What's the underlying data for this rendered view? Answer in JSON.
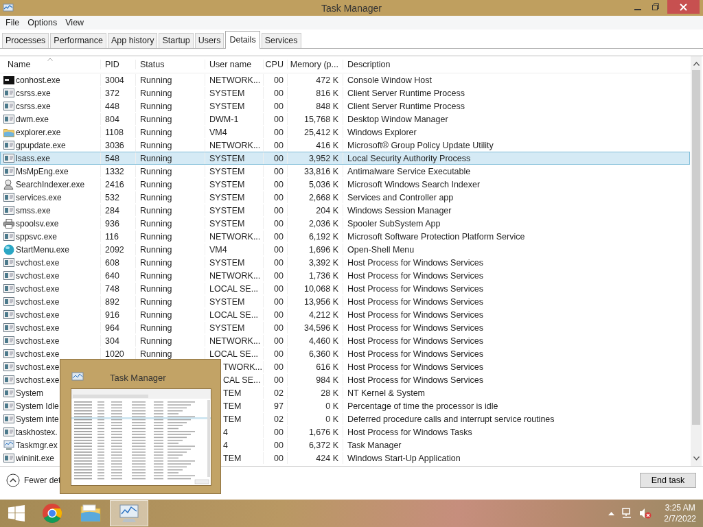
{
  "window": {
    "title": "Task Manager"
  },
  "menu": [
    "File",
    "Options",
    "View"
  ],
  "tabs": [
    {
      "label": "Processes",
      "selected": false
    },
    {
      "label": "Performance",
      "selected": false
    },
    {
      "label": "App history",
      "selected": false
    },
    {
      "label": "Startup",
      "selected": false
    },
    {
      "label": "Users",
      "selected": false
    },
    {
      "label": "Details",
      "selected": true
    },
    {
      "label": "Services",
      "selected": false
    }
  ],
  "table": {
    "columns": [
      "Name",
      "PID",
      "Status",
      "User name",
      "CPU",
      "Memory (p...",
      "Description"
    ],
    "rows": [
      {
        "kind": "console",
        "name": "conhost.exe",
        "pid": "3004",
        "status": "Running",
        "user": "NETWORK...",
        "cpu": "00",
        "memory": "472 K",
        "description": "Console Window Host",
        "selected": false
      },
      {
        "kind": "app",
        "name": "csrss.exe",
        "pid": "372",
        "status": "Running",
        "user": "SYSTEM",
        "cpu": "00",
        "memory": "816 K",
        "description": "Client Server Runtime Process",
        "selected": false
      },
      {
        "kind": "app",
        "name": "csrss.exe",
        "pid": "448",
        "status": "Running",
        "user": "SYSTEM",
        "cpu": "00",
        "memory": "848 K",
        "description": "Client Server Runtime Process",
        "selected": false
      },
      {
        "kind": "app",
        "name": "dwm.exe",
        "pid": "804",
        "status": "Running",
        "user": "DWM-1",
        "cpu": "00",
        "memory": "15,768 K",
        "description": "Desktop Window Manager",
        "selected": false
      },
      {
        "kind": "folder",
        "name": "explorer.exe",
        "pid": "1108",
        "status": "Running",
        "user": "VM4",
        "cpu": "00",
        "memory": "25,412 K",
        "description": "Windows Explorer",
        "selected": false
      },
      {
        "kind": "app",
        "name": "gpupdate.exe",
        "pid": "3036",
        "status": "Running",
        "user": "NETWORK...",
        "cpu": "00",
        "memory": "416 K",
        "description": "Microsoft® Group Policy Update Utility",
        "selected": false
      },
      {
        "kind": "app",
        "name": "lsass.exe",
        "pid": "548",
        "status": "Running",
        "user": "SYSTEM",
        "cpu": "00",
        "memory": "3,952 K",
        "description": "Local Security Authority Process",
        "selected": true
      },
      {
        "kind": "app",
        "name": "MsMpEng.exe",
        "pid": "1332",
        "status": "Running",
        "user": "SYSTEM",
        "cpu": "00",
        "memory": "33,816 K",
        "description": "Antimalware Service Executable",
        "selected": false
      },
      {
        "kind": "search",
        "name": "SearchIndexer.exe",
        "pid": "2416",
        "status": "Running",
        "user": "SYSTEM",
        "cpu": "00",
        "memory": "5,036 K",
        "description": "Microsoft Windows Search Indexer",
        "selected": false
      },
      {
        "kind": "app",
        "name": "services.exe",
        "pid": "532",
        "status": "Running",
        "user": "SYSTEM",
        "cpu": "00",
        "memory": "2,668 K",
        "description": "Services and Controller app",
        "selected": false
      },
      {
        "kind": "app",
        "name": "smss.exe",
        "pid": "284",
        "status": "Running",
        "user": "SYSTEM",
        "cpu": "00",
        "memory": "204 K",
        "description": "Windows Session Manager",
        "selected": false
      },
      {
        "kind": "printer",
        "name": "spoolsv.exe",
        "pid": "936",
        "status": "Running",
        "user": "SYSTEM",
        "cpu": "00",
        "memory": "2,036 K",
        "description": "Spooler SubSystem App",
        "selected": false
      },
      {
        "kind": "app",
        "name": "sppsvc.exe",
        "pid": "116",
        "status": "Running",
        "user": "NETWORK...",
        "cpu": "00",
        "memory": "6,192 K",
        "description": "Microsoft Software Protection Platform Service",
        "selected": false
      },
      {
        "kind": "sphere",
        "name": "StartMenu.exe",
        "pid": "2092",
        "status": "Running",
        "user": "VM4",
        "cpu": "00",
        "memory": "1,696 K",
        "description": "Open-Shell Menu",
        "selected": false
      },
      {
        "kind": "app",
        "name": "svchost.exe",
        "pid": "608",
        "status": "Running",
        "user": "SYSTEM",
        "cpu": "00",
        "memory": "3,392 K",
        "description": "Host Process for Windows Services",
        "selected": false
      },
      {
        "kind": "app",
        "name": "svchost.exe",
        "pid": "640",
        "status": "Running",
        "user": "NETWORK...",
        "cpu": "00",
        "memory": "1,736 K",
        "description": "Host Process for Windows Services",
        "selected": false
      },
      {
        "kind": "app",
        "name": "svchost.exe",
        "pid": "748",
        "status": "Running",
        "user": "LOCAL SE...",
        "cpu": "00",
        "memory": "10,068 K",
        "description": "Host Process for Windows Services",
        "selected": false
      },
      {
        "kind": "app",
        "name": "svchost.exe",
        "pid": "892",
        "status": "Running",
        "user": "SYSTEM",
        "cpu": "00",
        "memory": "13,956 K",
        "description": "Host Process for Windows Services",
        "selected": false
      },
      {
        "kind": "app",
        "name": "svchost.exe",
        "pid": "916",
        "status": "Running",
        "user": "LOCAL SE...",
        "cpu": "00",
        "memory": "4,212 K",
        "description": "Host Process for Windows Services",
        "selected": false
      },
      {
        "kind": "app",
        "name": "svchost.exe",
        "pid": "964",
        "status": "Running",
        "user": "SYSTEM",
        "cpu": "00",
        "memory": "34,596 K",
        "description": "Host Process for Windows Services",
        "selected": false
      },
      {
        "kind": "app",
        "name": "svchost.exe",
        "pid": "304",
        "status": "Running",
        "user": "NETWORK...",
        "cpu": "00",
        "memory": "4,460 K",
        "description": "Host Process for Windows Services",
        "selected": false
      },
      {
        "kind": "app",
        "name": "svchost.exe",
        "pid": "1020",
        "status": "Running",
        "user": "LOCAL SE...",
        "cpu": "00",
        "memory": "6,360 K",
        "description": "Host Process for Windows Services",
        "selected": false
      },
      {
        "kind": "app",
        "name": "svchost.exe",
        "user": "TWORK...",
        "cpu": "00",
        "memory": "616 K",
        "description": "Host Process for Windows Services",
        "selected": false
      },
      {
        "kind": "app",
        "name": "svchost.exe",
        "user": "CAL SE...",
        "cpu": "00",
        "memory": "984 K",
        "description": "Host Process for Windows Services",
        "selected": false
      },
      {
        "kind": "app",
        "name": "System",
        "user": "TEM",
        "cpu": "02",
        "memory": "28 K",
        "description": "NT Kernel & System",
        "selected": false
      },
      {
        "kind": "app",
        "name": "System Idle",
        "user": "TEM",
        "cpu": "97",
        "memory": "0 K",
        "description": "Percentage of time the processor is idle",
        "selected": false
      },
      {
        "kind": "app",
        "name": "System inte",
        "user": "TEM",
        "cpu": "02",
        "memory": "0 K",
        "description": "Deferred procedure calls and interrupt service routines",
        "selected": false
      },
      {
        "kind": "app",
        "name": "taskhostex.",
        "user": "4",
        "cpu": "00",
        "memory": "1,676 K",
        "description": "Host Process for Windows Tasks",
        "selected": false
      },
      {
        "kind": "chart",
        "name": "Taskmgr.ex",
        "user": "4",
        "cpu": "00",
        "memory": "6,372 K",
        "description": "Task Manager",
        "selected": false
      },
      {
        "kind": "app",
        "name": "wininit.exe",
        "user": "TEM",
        "cpu": "00",
        "memory": "424 K",
        "description": "Windows Start-Up Application",
        "selected": false
      }
    ]
  },
  "footer": {
    "details_link": "Fewer det",
    "end_task": "End task"
  },
  "preview": {
    "title": "Task Manager"
  },
  "taskbar": {
    "apps": [
      {
        "kind": "browser",
        "selected": false
      },
      {
        "kind": "folder",
        "selected": false
      },
      {
        "kind": "taskmgr",
        "selected": true
      }
    ],
    "time": "3:25 AM",
    "date": "2/7/2022"
  }
}
